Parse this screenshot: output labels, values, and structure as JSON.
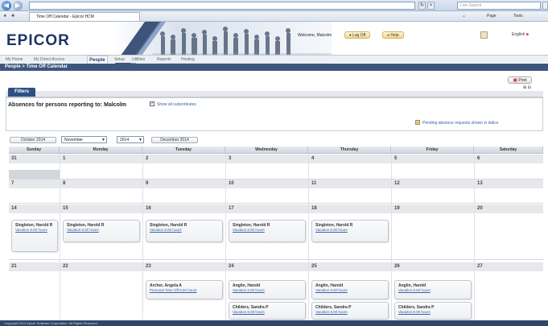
{
  "browser": {
    "back_icon": "back-arrow-icon",
    "forward_icon": "forward-arrow-icon",
    "tab_label": "Time Off Calendar - Epicor HCM",
    "search_placeholder": "Live Search",
    "toolbar_items": [
      "Page",
      "Tools"
    ]
  },
  "header": {
    "logo": "EPICOR",
    "welcome": "Welcome, Malcolm",
    "log_off": "Log Off",
    "help": "Help",
    "lang": "English"
  },
  "menu": {
    "items": [
      "My Home",
      "My Direct Access",
      "People",
      "Setup",
      "Utilities",
      "Reports",
      "Hosting"
    ],
    "active": "People"
  },
  "breadcrumb": "People > Time Off Calendar",
  "print_label": "Print",
  "filters": {
    "tab": "Filters",
    "title": "Absences for persons reporting to: Malcolm",
    "include_indirect": "Show all subordinates",
    "pending_note": "Pending absence requests shown in italics"
  },
  "nav": {
    "prev": "October 2014",
    "month": "November",
    "year": "2014",
    "next": "December 2014"
  },
  "days": [
    "Sunday",
    "Monday",
    "Tuesday",
    "Wednesday",
    "Thursday",
    "Friday",
    "Saturday"
  ],
  "weeks": [
    [
      "31",
      "1",
      "2",
      "3",
      "4",
      "5",
      "6"
    ],
    [
      "7",
      "8",
      "9",
      "10",
      "11",
      "12",
      "13"
    ],
    [
      "14",
      "15",
      "16",
      "17",
      "18",
      "19",
      "20"
    ],
    [
      "21",
      "22",
      "23",
      "24",
      "25",
      "26",
      "27"
    ]
  ],
  "entries": {
    "w3": [
      {
        "name": "Singleton, Harold R",
        "link": "Vacation 8.00 hours"
      },
      {
        "name": "Singleton, Harold R",
        "link": "Vacation 8.00 hours"
      },
      {
        "name": "Singleton, Harold R",
        "link": "Vacation 8.00 hours"
      },
      {
        "name": "Singleton, Harold R",
        "link": "Vacation 8.00 hours"
      },
      {
        "name": "Singleton, Harold R",
        "link": "Vacation 8.00 hours"
      }
    ],
    "w4_tue": {
      "name": "Archer, Angela A",
      "link": "Personal Time Off 8.00 hours"
    },
    "w4_wed": [
      {
        "name": "Anglin, Harold",
        "link": "Vacation 8.00 hours"
      },
      {
        "name": "Childers, Sandra P",
        "link": "Vacation 8.00 hours"
      }
    ],
    "w4_thu": [
      {
        "name": "Anglin, Harold",
        "link": "Vacation 8.00 hours"
      },
      {
        "name": "Childers, Sandra P",
        "link": "Vacation 8.00 hours"
      }
    ],
    "w4_fri": [
      {
        "name": "Anglin, Harold",
        "link": "Vacation 8.00 hours"
      },
      {
        "name": "Childers, Sandra P",
        "link": "Vacation 8.00 hours"
      }
    ]
  },
  "footer": "Copyright 2014 Epicor Software Corporation. All Rights Reserved."
}
